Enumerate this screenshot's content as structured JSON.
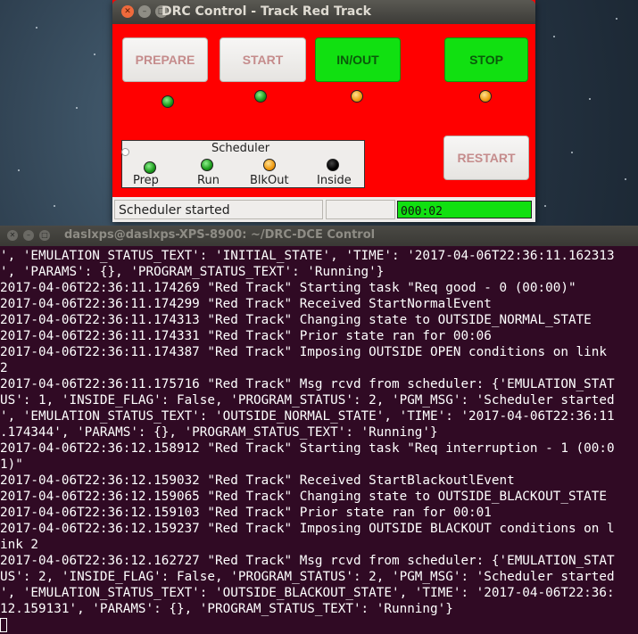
{
  "drc_window": {
    "title": "DRC Control - Track Red Track",
    "buttons": {
      "prepare": "PREPARE",
      "start": "START",
      "in_out": "IN/OUT",
      "stop": "STOP",
      "restart": "RESTART"
    },
    "scheduler": {
      "title": "Scheduler",
      "indicators": [
        {
          "label": "Prep",
          "state": "green"
        },
        {
          "label": "Run",
          "state": "green"
        },
        {
          "label": "BlkOut",
          "state": "orange"
        },
        {
          "label": "Inside",
          "state": "black"
        }
      ]
    },
    "status": {
      "message": "Scheduler started",
      "middle": "",
      "timer": "000:02"
    },
    "colors": {
      "background": "#ff0000",
      "active_button": "#11e011",
      "timer_bar": "#11e011"
    }
  },
  "terminal": {
    "title": "daslxps@daslxps-XPS-8900: ~/DRC-DCE Control",
    "lines": [
      "', 'EMULATION_STATUS_TEXT': 'INITIAL_STATE', 'TIME': '2017-04-06T22:36:11.162313",
      "', 'PARAMS': {}, 'PROGRAM_STATUS_TEXT': 'Running'}",
      "2017-04-06T22:36:11.174269 \"Red Track\" Starting task \"Req good - 0 (00:00)\"",
      "2017-04-06T22:36:11.174299 \"Red Track\" Received StartNormalEvent",
      "2017-04-06T22:36:11.174313 \"Red Track\" Changing state to OUTSIDE_NORMAL_STATE",
      "2017-04-06T22:36:11.174331 \"Red Track\" Prior state ran for 00:06",
      "2017-04-06T22:36:11.174387 \"Red Track\" Imposing OUTSIDE OPEN conditions on link",
      "2",
      "2017-04-06T22:36:11.175716 \"Red Track\" Msg rcvd from scheduler: {'EMULATION_STAT",
      "US': 1, 'INSIDE_FLAG': False, 'PROGRAM_STATUS': 2, 'PGM_MSG': 'Scheduler started",
      "', 'EMULATION_STATUS_TEXT': 'OUTSIDE_NORMAL_STATE', 'TIME': '2017-04-06T22:36:11",
      ".174344', 'PARAMS': {}, 'PROGRAM_STATUS_TEXT': 'Running'}",
      "2017-04-06T22:36:12.158912 \"Red Track\" Starting task \"Req interruption - 1 (00:0",
      "1)\"",
      "2017-04-06T22:36:12.159032 \"Red Track\" Received StartBlackoutlEvent",
      "2017-04-06T22:36:12.159065 \"Red Track\" Changing state to OUTSIDE_BLACKOUT_STATE",
      "2017-04-06T22:36:12.159103 \"Red Track\" Prior state ran for 00:01",
      "2017-04-06T22:36:12.159237 \"Red Track\" Imposing OUTSIDE BLACKOUT conditions on l",
      "ink 2",
      "2017-04-06T22:36:12.162727 \"Red Track\" Msg rcvd from scheduler: {'EMULATION_STAT",
      "US': 2, 'INSIDE_FLAG': False, 'PROGRAM_STATUS': 2, 'PGM_MSG': 'Scheduler started",
      "', 'EMULATION_STATUS_TEXT': 'OUTSIDE_BLACKOUT_STATE', 'TIME': '2017-04-06T22:36:",
      "12.159131', 'PARAMS': {}, 'PROGRAM_STATUS_TEXT': 'Running'}"
    ],
    "colors": {
      "background": "#300a24",
      "text": "#ffffff"
    }
  }
}
